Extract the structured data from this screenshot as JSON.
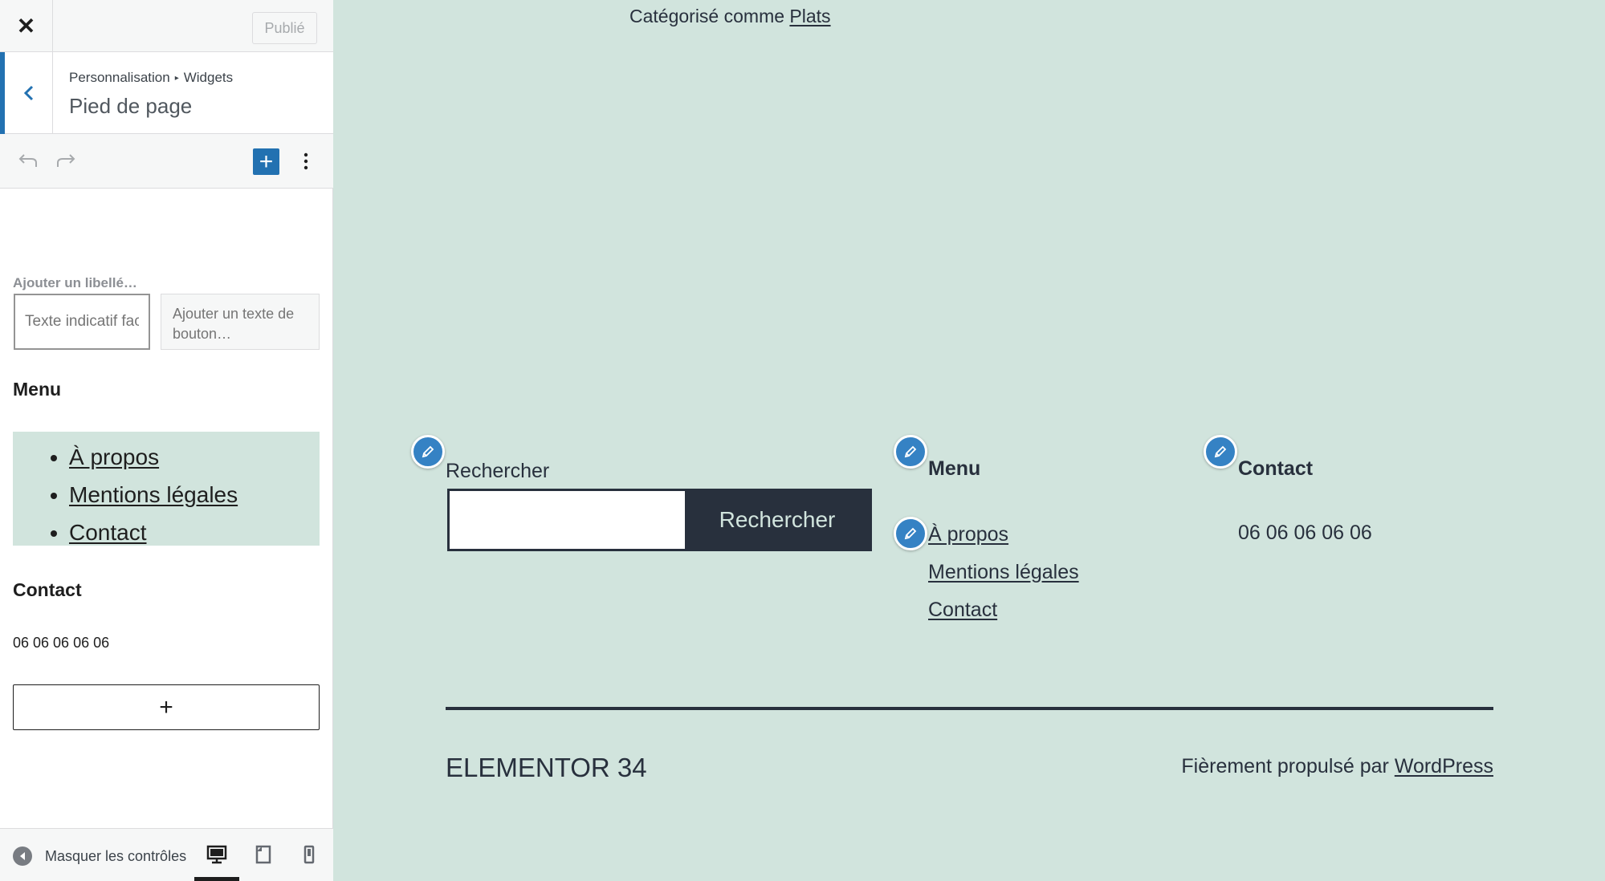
{
  "sidebar": {
    "close_icon": "close-icon",
    "publish_label": "Publié",
    "breadcrumb": [
      "Personnalisation",
      "Widgets"
    ],
    "section_title": "Pied de page",
    "search_block": {
      "label_placeholder": "Ajouter un libellé…",
      "input_placeholder": "Texte indicatif facultatif…",
      "button_placeholder": "Ajouter un texte de bouton…"
    },
    "menu_block": {
      "heading": "Menu",
      "items": [
        "À propos",
        "Mentions légales",
        "Contact"
      ]
    },
    "contact_block": {
      "heading": "Contact",
      "phone": "06 06 06 06 06"
    },
    "append_label": "+",
    "collapse_label": "Masquer les contrôles",
    "device_selected": "desktop"
  },
  "preview": {
    "category_prefix": "Catégorisé comme",
    "category_link": "Plats",
    "search_widget": {
      "label": "Rechercher",
      "button": "Rechercher"
    },
    "menu_widget": {
      "title": "Menu",
      "items": [
        "À propos",
        "Mentions légales",
        "Contact"
      ]
    },
    "contact_widget": {
      "title": "Contact",
      "phone": "06 06 06 06 06"
    },
    "site_name": "ELEMENTOR 34",
    "powered_prefix": "Fièrement propulsé par",
    "powered_link": "WordPress"
  },
  "colors": {
    "accent": "#2271b1",
    "edit_shortcut": "#3582c4",
    "preview_bg": "#d1e4dd",
    "dark": "#28303d"
  }
}
